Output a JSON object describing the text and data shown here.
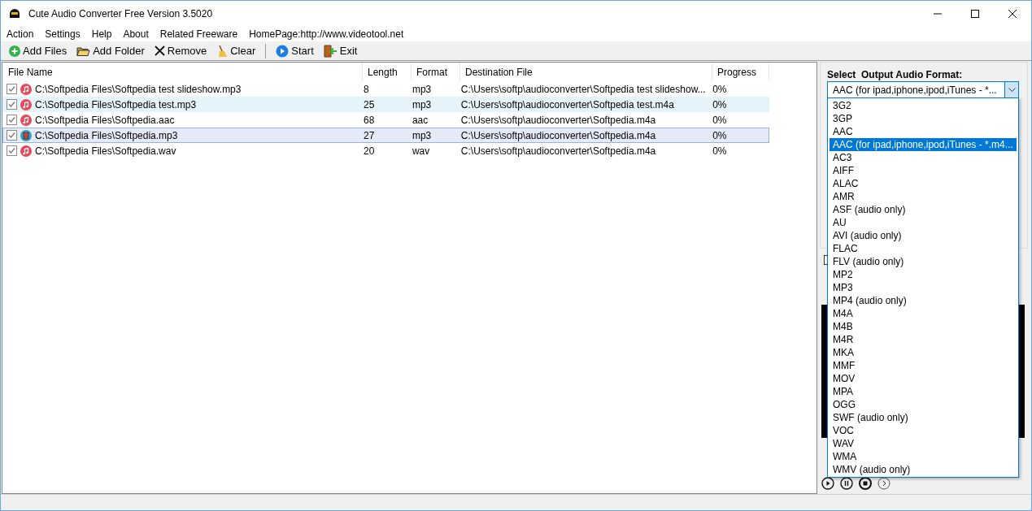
{
  "window": {
    "title": "Cute Audio Converter Free Version 3.5020"
  },
  "menu": [
    "Action",
    "Settings",
    "Help",
    "About",
    "Related Freeware",
    "HomePage:http://www.videotool.net"
  ],
  "toolbar": [
    {
      "kind": "add",
      "label": "Add Files"
    },
    {
      "kind": "folder",
      "label": "Add Folder"
    },
    {
      "kind": "remove",
      "label": "Remove"
    },
    {
      "kind": "clear",
      "label": "Clear"
    },
    {
      "kind": "start",
      "label": "Start"
    },
    {
      "kind": "exit",
      "label": "Exit"
    }
  ],
  "table": {
    "columns": [
      "File Name",
      "Length",
      "Format",
      "Destination File",
      "Progress"
    ],
    "rows": [
      {
        "checked": true,
        "kind": "music",
        "selected": false,
        "hovered": false,
        "cells": [
          "C:\\Softpedia Files\\Softpedia test slideshow.mp3",
          "8",
          "mp3",
          "C:\\Users\\softp\\audioconverter\\Softpedia test slideshow...",
          "0%"
        ]
      },
      {
        "checked": true,
        "kind": "music",
        "selected": false,
        "hovered": true,
        "cells": [
          "C:\\Softpedia Files\\Softpedia test.mp3",
          "25",
          "mp3",
          "C:\\Users\\softp\\audioconverter\\Softpedia test.m4a",
          "0%"
        ]
      },
      {
        "checked": true,
        "kind": "music",
        "selected": false,
        "hovered": false,
        "cells": [
          "C:\\Softpedia Files\\Softpedia.aac",
          "68",
          "aac",
          "C:\\Users\\softp\\audioconverter\\Softpedia.m4a",
          "0%"
        ]
      },
      {
        "checked": true,
        "kind": "film",
        "selected": true,
        "hovered": false,
        "cells": [
          "C:\\Softpedia Files\\Softpedia.mp3",
          "27",
          "mp3",
          "C:\\Users\\softp\\audioconverter\\Softpedia.m4a",
          "0%"
        ]
      },
      {
        "checked": true,
        "kind": "music",
        "selected": false,
        "hovered": false,
        "cells": [
          "C:\\Softpedia Files\\Softpedia.wav",
          "20",
          "wav",
          "C:\\Users\\softp\\audioconverter\\Softpedia.m4a",
          "0%"
        ]
      }
    ]
  },
  "output_format": {
    "label": "Select  Output Audio Format:",
    "value": "AAC (for ipad,iphone,ipod,iTunes - *...",
    "options": [
      {
        "label": "3G2",
        "selected": false
      },
      {
        "label": "3GP",
        "selected": false
      },
      {
        "label": "AAC",
        "selected": false
      },
      {
        "label": "AAC (for ipad,iphone,ipod,iTunes - *.m4...",
        "selected": true
      },
      {
        "label": "AC3",
        "selected": false
      },
      {
        "label": "AIFF",
        "selected": false
      },
      {
        "label": "ALAC",
        "selected": false
      },
      {
        "label": "AMR",
        "selected": false
      },
      {
        "label": "ASF (audio only)",
        "selected": false
      },
      {
        "label": "AU",
        "selected": false
      },
      {
        "label": "AVI (audio only)",
        "selected": false
      },
      {
        "label": "FLAC",
        "selected": false
      },
      {
        "label": "FLV (audio only)",
        "selected": false
      },
      {
        "label": "MP2",
        "selected": false
      },
      {
        "label": "MP3",
        "selected": false
      },
      {
        "label": "MP4 (audio only)",
        "selected": false
      },
      {
        "label": "M4A",
        "selected": false
      },
      {
        "label": "M4B",
        "selected": false
      },
      {
        "label": "M4R",
        "selected": false
      },
      {
        "label": "MKA",
        "selected": false
      },
      {
        "label": "MMF",
        "selected": false
      },
      {
        "label": "MOV",
        "selected": false
      },
      {
        "label": "MPA",
        "selected": false
      },
      {
        "label": "OGG",
        "selected": false
      },
      {
        "label": "SWF (audio only)",
        "selected": false
      },
      {
        "label": "VOC",
        "selected": false
      },
      {
        "label": "WAV",
        "selected": false
      },
      {
        "label": "WMA",
        "selected": false
      },
      {
        "label": "WMV (audio only)",
        "selected": false
      }
    ]
  },
  "player": [
    {
      "kind": "play"
    },
    {
      "kind": "pause"
    },
    {
      "kind": "stop"
    },
    {
      "kind": "next"
    }
  ]
}
